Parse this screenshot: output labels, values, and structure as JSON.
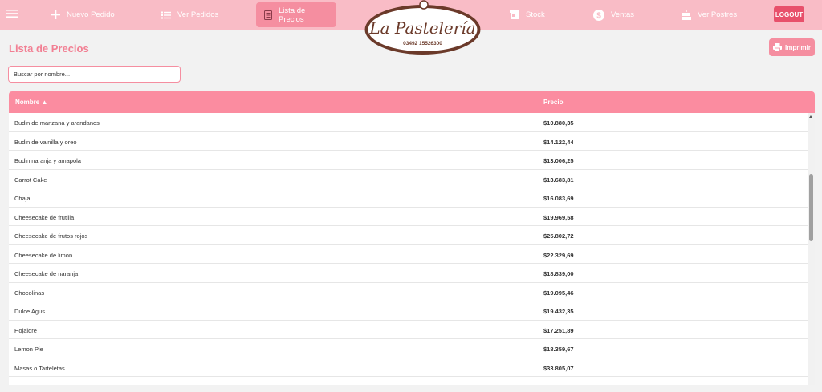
{
  "nav": {
    "items": [
      {
        "label": "Nuevo Pedido",
        "icon": "plus-icon"
      },
      {
        "label": "Ver Pedidos",
        "icon": "list-icon"
      },
      {
        "label": "Lista de Precios",
        "icon": "book-icon",
        "active": true
      },
      {
        "label": "Stock",
        "icon": "store-icon"
      },
      {
        "label": "Ventas",
        "icon": "dollar-icon"
      },
      {
        "label": "Ver Postres",
        "icon": "cake-icon"
      }
    ],
    "logout_label": "LOGOUT"
  },
  "logo": {
    "name": "La Pastelería",
    "phone": "03492 15526300"
  },
  "page": {
    "title": "Lista de Precios",
    "print_label": "Imprimir"
  },
  "search": {
    "placeholder": "Buscar por nombre..."
  },
  "table": {
    "headers": {
      "name": "Nombre ▲",
      "price": "Precio"
    },
    "rows": [
      {
        "name": "Budin de manzana y arandanos",
        "price": "$10.880,35"
      },
      {
        "name": "Budin de vainilla y oreo",
        "price": "$14.122,44"
      },
      {
        "name": "Budin naranja y amapola",
        "price": "$13.006,25"
      },
      {
        "name": "Carrot Cake",
        "price": "$13.683,81"
      },
      {
        "name": "Chaja",
        "price": "$16.083,69"
      },
      {
        "name": "Cheesecake de frutilla",
        "price": "$19.969,58"
      },
      {
        "name": "Cheesecake de frutos rojos",
        "price": "$25.802,72"
      },
      {
        "name": "Cheesecake de limon",
        "price": "$22.329,69"
      },
      {
        "name": "Cheesecake de naranja",
        "price": "$18.839,00"
      },
      {
        "name": "Chocolinas",
        "price": "$19.095,46"
      },
      {
        "name": "Dulce Agus",
        "price": "$19.432,35"
      },
      {
        "name": "Hojaldre",
        "price": "$17.251,89"
      },
      {
        "name": "Lemon Pie",
        "price": "$18.359,67"
      },
      {
        "name": "Masas o Tarteletas",
        "price": "$33.805,07"
      }
    ]
  },
  "colors": {
    "topbar": "#f9bcc6",
    "accent": "#f58ea0",
    "title": "#f27f93",
    "logout": "#e8506b",
    "logo_brown": "#6b3a2a"
  }
}
